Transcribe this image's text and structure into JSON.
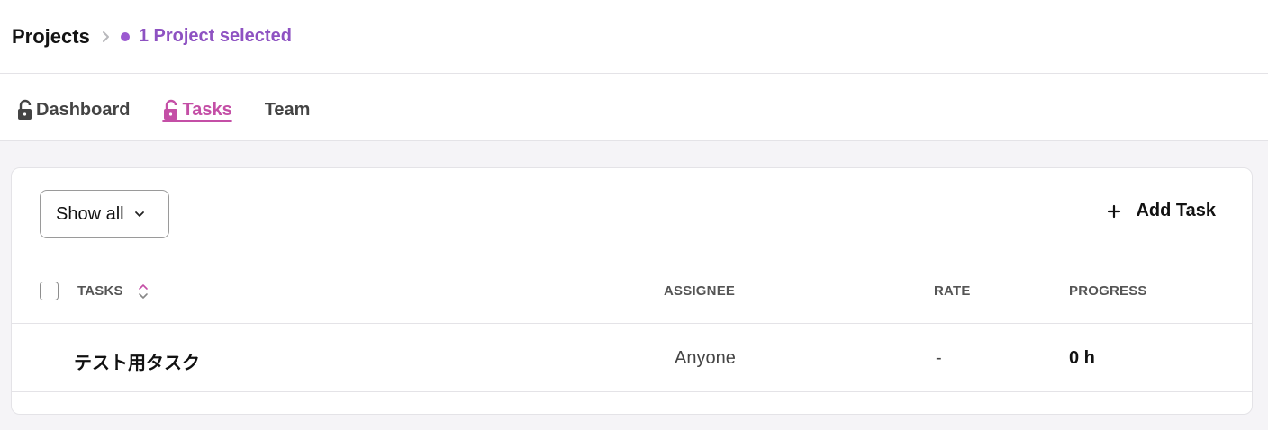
{
  "breadcrumb": {
    "root": "Projects",
    "current": "1 Project selected",
    "accent_color": "#8e52c2"
  },
  "tabs": [
    {
      "label": "Dashboard",
      "icon": "lock-open-icon",
      "active": false
    },
    {
      "label": "Tasks",
      "icon": "lock-open-icon",
      "active": true
    },
    {
      "label": "Team",
      "icon": null,
      "active": false
    }
  ],
  "toolbar": {
    "filter_label": "Show all",
    "add_label": "Add Task"
  },
  "table": {
    "headers": {
      "tasks": "TASKS",
      "assignee": "ASSIGNEE",
      "rate": "RATE",
      "progress": "PROGRESS"
    },
    "rows": [
      {
        "task": "テスト用タスク",
        "assignee": "Anyone",
        "rate": "-",
        "progress": "0 h"
      }
    ]
  },
  "colors": {
    "active_tab": "#c44fa6",
    "background": "#f5f4f7"
  }
}
